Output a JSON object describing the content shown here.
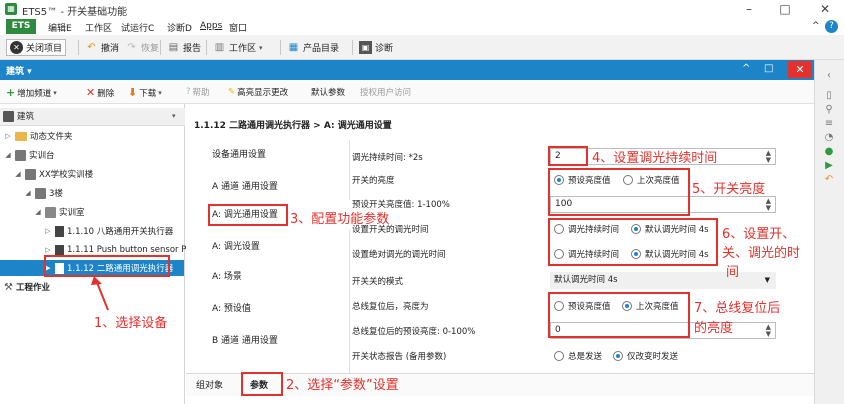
{
  "window": {
    "title": "ETS5™ - 开关基础功能",
    "minimize": "–",
    "maximize": "□",
    "close": "✕"
  },
  "menubar": {
    "ets": "ETS",
    "items": [
      "编辑E",
      "工作区",
      "试运行C",
      "诊断D",
      "Apps",
      "窗口"
    ],
    "chevron": "^",
    "help": "?"
  },
  "toolbar": {
    "close_project": "关闭项目",
    "undo": "撤消",
    "redo": "恢复",
    "report": "报告",
    "workspace": "工作区",
    "catalog": "产品目录",
    "diagnostics": "诊断"
  },
  "panel": {
    "title": "建筑",
    "minimize": "^",
    "restore": "□",
    "close": "✕"
  },
  "subtoolbar": {
    "add_channel": "增加频道",
    "delete": "删除",
    "download": "下载",
    "help": "帮助",
    "highlight": "高亮显示更改",
    "default_params": "默认参数",
    "authorize": "授权用户访问"
  },
  "tree": {
    "root": "建筑",
    "items": [
      {
        "label": "动态文件夹",
        "level": 1
      },
      {
        "label": "实训台",
        "level": 1
      },
      {
        "label": "XX学校实训楼",
        "level": 2
      },
      {
        "label": "3楼",
        "level": 3
      },
      {
        "label": "实训室",
        "level": 4
      },
      {
        "label": "1.1.10 八路通用开关执行器",
        "level": 5
      },
      {
        "label": "1.1.11 Push button sensor Plu...",
        "level": 5
      },
      {
        "label": "1.1.12 二路通用调光执行器",
        "level": 5,
        "selected": true
      }
    ],
    "work": "工程作业"
  },
  "main": {
    "breadcrumb": "1.1.12 二路通用调光执行器 > A: 调光通用设置",
    "nav": [
      "设备通用设置",
      "A 通道 通用设置",
      "A: 调光通用设置",
      "A: 调光设置",
      "A: 场景",
      "A: 预设值",
      "B 通道 通用设置"
    ],
    "params": {
      "dim_duration": {
        "label": "调光持续时间: *2s",
        "value": "2"
      },
      "switch_on_brightness": {
        "label": "开关的亮度",
        "opt1": "预设亮度值",
        "opt2": "上次亮度值"
      },
      "preset_on_brightness": {
        "label": "预设开关亮度值: 1-100%",
        "value": "100"
      },
      "switch_dim_time": {
        "label": "设置开关的调光时间",
        "opt1": "调光持续时间",
        "opt2": "默认调光时间 4s"
      },
      "absolute_dim_time": {
        "label": "设置绝对调光的调光时间",
        "opt1": "调光持续时间",
        "opt2": "默认调光时间 4s"
      },
      "switch_mode": {
        "label": "开关关的模式",
        "value": "默认调光时间 4s"
      },
      "bus_recovery": {
        "label": "总线复位后，亮度为",
        "opt1": "预设亮度值",
        "opt2": "上次亮度值"
      },
      "bus_recovery_preset": {
        "label": "总线复位后的预设亮度: 0-100%",
        "value": "0"
      },
      "status_report": {
        "label": "开关状态报告 (备用参数)",
        "opt1": "总是发送",
        "opt2": "仅改变时发送"
      }
    },
    "tabs": [
      "组对象",
      "参数"
    ]
  },
  "annotations": {
    "a1": "1、选择设备",
    "a2": "2、选择“参数”设置",
    "a3": "3、配置功能参数",
    "a4": "4、设置调光持续时间",
    "a5": "5、开关亮度",
    "a6_l1": "6、设置开、",
    "a6_l2": "关、调光的时",
    "a6_l3": "间",
    "a7_l1": "7、总线复位后",
    "a7_l2": "的亮度"
  },
  "colors": {
    "accent": "#1e84c8",
    "annotation": "#e3312d",
    "ets_green": "#2e8b3e"
  }
}
